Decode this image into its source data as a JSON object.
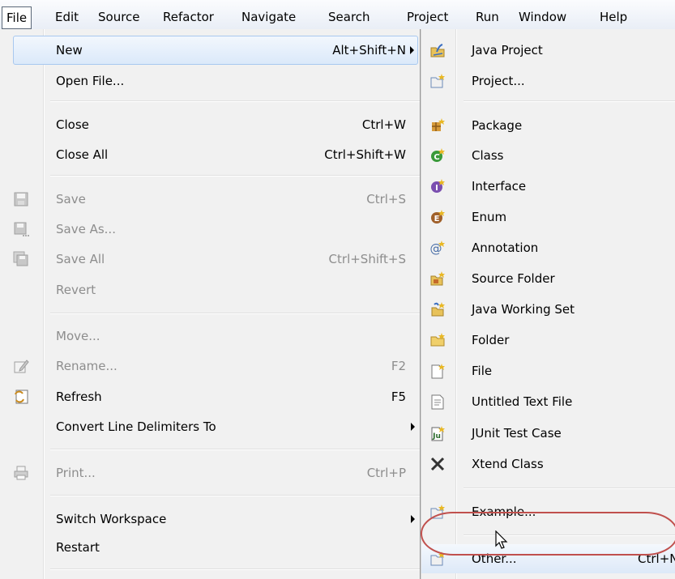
{
  "menubar": {
    "items": [
      {
        "label": "File"
      },
      {
        "label": "Edit"
      },
      {
        "label": "Source"
      },
      {
        "label": "Refactor"
      },
      {
        "label": "Navigate"
      },
      {
        "label": "Search"
      },
      {
        "label": "Project"
      },
      {
        "label": "Run"
      },
      {
        "label": "Window"
      },
      {
        "label": "Help"
      }
    ]
  },
  "file_menu": {
    "new": {
      "label": "New",
      "accel": "Alt+Shift+N"
    },
    "open_file": {
      "label": "Open File..."
    },
    "close": {
      "label": "Close",
      "accel": "Ctrl+W"
    },
    "close_all": {
      "label": "Close All",
      "accel": "Ctrl+Shift+W"
    },
    "save": {
      "label": "Save",
      "accel": "Ctrl+S",
      "icon": "save-icon"
    },
    "save_as": {
      "label": "Save As...",
      "icon": "save-as-icon"
    },
    "save_all": {
      "label": "Save All",
      "accel": "Ctrl+Shift+S",
      "icon": "save-all-icon"
    },
    "revert": {
      "label": "Revert"
    },
    "move": {
      "label": "Move..."
    },
    "rename": {
      "label": "Rename...",
      "accel": "F2",
      "icon": "rename-icon"
    },
    "refresh": {
      "label": "Refresh",
      "accel": "F5",
      "icon": "refresh-icon"
    },
    "convert": {
      "label": "Convert Line Delimiters To"
    },
    "print": {
      "label": "Print...",
      "accel": "Ctrl+P",
      "icon": "print-icon"
    },
    "switch_workspace": {
      "label": "Switch Workspace"
    },
    "restart": {
      "label": "Restart"
    }
  },
  "new_menu": {
    "java_project": {
      "label": "Java Project",
      "icon": "java-project-icon"
    },
    "project": {
      "label": "Project...",
      "icon": "project-icon"
    },
    "package": {
      "label": "Package",
      "icon": "package-icon"
    },
    "class": {
      "label": "Class",
      "icon": "class-icon"
    },
    "interface": {
      "label": "Interface",
      "icon": "interface-icon"
    },
    "enum": {
      "label": "Enum",
      "icon": "enum-icon"
    },
    "annotation": {
      "label": "Annotation",
      "icon": "annotation-icon"
    },
    "source_folder": {
      "label": "Source Folder",
      "icon": "source-folder-icon"
    },
    "working_set": {
      "label": "Java Working Set",
      "icon": "working-set-icon"
    },
    "folder": {
      "label": "Folder",
      "icon": "folder-icon"
    },
    "file": {
      "label": "File",
      "icon": "file-icon"
    },
    "untitled_text": {
      "label": "Untitled Text File",
      "icon": "text-file-icon"
    },
    "junit": {
      "label": "JUnit Test Case",
      "icon": "junit-icon"
    },
    "xtend": {
      "label": "Xtend Class",
      "icon": "xtend-icon"
    },
    "example": {
      "label": "Example...",
      "icon": "example-icon"
    },
    "other": {
      "label": "Other...",
      "accel": "Ctrl+N",
      "icon": "other-wizard-icon"
    }
  },
  "colors": {
    "highlight_oval": "#c0504d",
    "disabled_text": "#8d8d8d",
    "class_green": "#3a9a3a",
    "interface_purple": "#7b4fb0",
    "enum_brown": "#a0602a"
  }
}
